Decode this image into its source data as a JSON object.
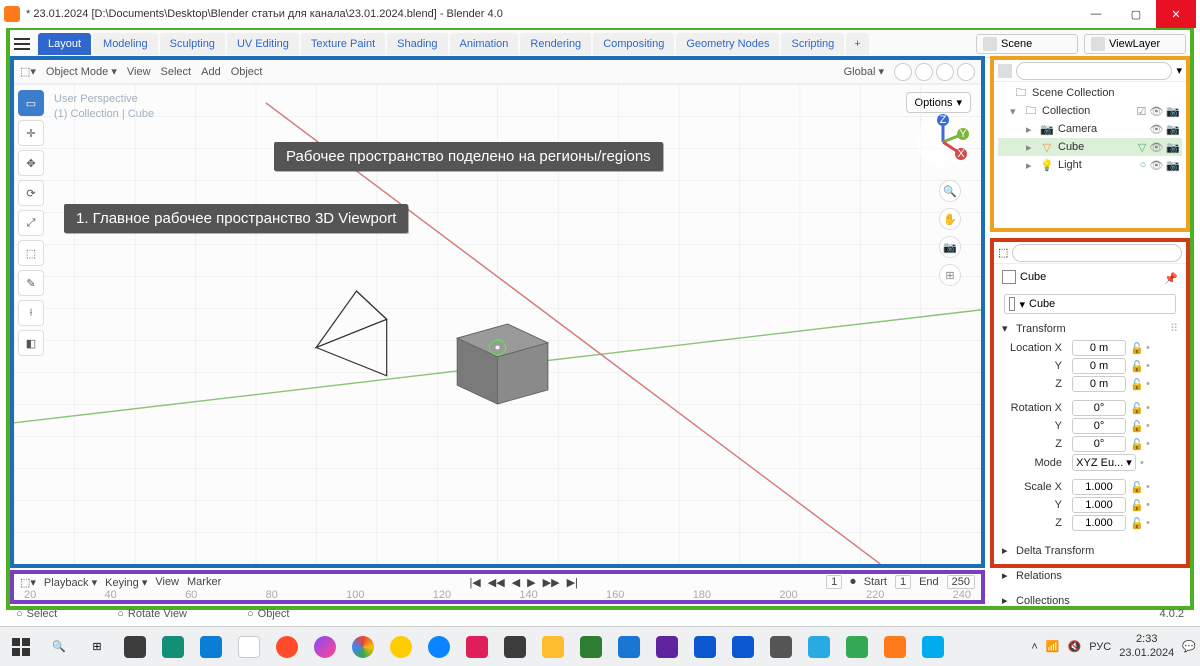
{
  "title": "* 23.01.2024 [D:\\Documents\\Desktop\\Blender статьи для канала\\23.01.2024.blend] - Blender 4.0",
  "workspaces": {
    "active": "Layout",
    "tabs": [
      "Layout",
      "Modeling",
      "Sculpting",
      "UV Editing",
      "Texture Paint",
      "Shading",
      "Animation",
      "Rendering",
      "Compositing",
      "Geometry Nodes",
      "Scripting"
    ]
  },
  "scene": {
    "label": "Scene",
    "viewlayer": "ViewLayer"
  },
  "viewport": {
    "mode": "Object Mode",
    "menus": [
      "View",
      "Select",
      "Add",
      "Object"
    ],
    "orientation": "Global",
    "options": "Options",
    "persp1": "User Perspective",
    "persp2": "(1) Collection | Cube"
  },
  "gizmo": {
    "x": "X",
    "y": "Y",
    "z": "Z"
  },
  "annotations": {
    "regions": "Рабочее пространство поделено на регионы/regions",
    "viewport_label": "1. Главное рабочее пространство 3D Viewport"
  },
  "outliner": {
    "root": "Scene Collection",
    "collection": "Collection",
    "items": [
      "Camera",
      "Cube",
      "Light"
    ]
  },
  "properties": {
    "object": "Cube",
    "name_field": "Cube",
    "panels": {
      "transform": "Transform",
      "delta": "Delta Transform",
      "relations": "Relations",
      "collections": "Collections"
    },
    "loc": {
      "label": "Location X",
      "y": "Y",
      "z": "Z",
      "vx": "0 m",
      "vy": "0 m",
      "vz": "0 m"
    },
    "rot": {
      "label": "Rotation X",
      "y": "Y",
      "z": "Z",
      "vx": "0°",
      "vy": "0°",
      "vz": "0°",
      "mode_lbl": "Mode",
      "mode": "XYZ Eu..."
    },
    "scale": {
      "label": "Scale X",
      "y": "Y",
      "z": "Z",
      "vx": "1.000",
      "vy": "1.000",
      "vz": "1.000"
    }
  },
  "timeline": {
    "menus": [
      "Playback",
      "Keying",
      "View",
      "Marker"
    ],
    "frame": "1",
    "start_lbl": "Start",
    "start": "1",
    "end_lbl": "End",
    "end": "250",
    "ticks": [
      "20",
      "40",
      "60",
      "80",
      "100",
      "120",
      "140",
      "160",
      "180",
      "200",
      "220",
      "240"
    ]
  },
  "status": {
    "a": "Select",
    "b": "Rotate View",
    "c": "Object",
    "ver": "4.0.2"
  },
  "tray": {
    "lang": "РУС",
    "time": "2:33",
    "date": "23.01.2024"
  }
}
